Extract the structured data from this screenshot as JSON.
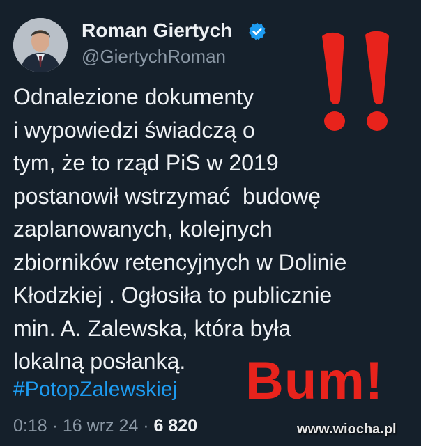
{
  "tweet": {
    "author_name": "Roman Giertych",
    "handle": "@GiertychRoman",
    "verified_icon": "verified-badge-icon",
    "body_lines": [
      "Odnalezione dokumenty",
      "i wypowiedzi świadczą o",
      "tym, że to rząd PiS w 2019",
      "postanowił wstrzymać  budowę",
      "zaplanowanych, kolejnych",
      "zbiorników retencyjnych w Dolinie",
      "Kłodzkiej . Ogłosiła to publicznie",
      "min. A. Zalewska, która była",
      "lokalną posłanką."
    ],
    "hashtag": "#PotopZalewskiej",
    "time": "0:18",
    "separator": "·",
    "date": "16 wrz 24",
    "views": "6 820"
  },
  "overlay": {
    "exclamation_text": "!!",
    "bum_text": "Bum!",
    "watermark": "www.wiocha.pl"
  },
  "colors": {
    "background": "#15202b",
    "text": "#eef1f4",
    "muted": "#8b98a5",
    "link": "#1d9bf0",
    "verified": "#1d9bf0",
    "overlay_red": "#e8231c"
  }
}
